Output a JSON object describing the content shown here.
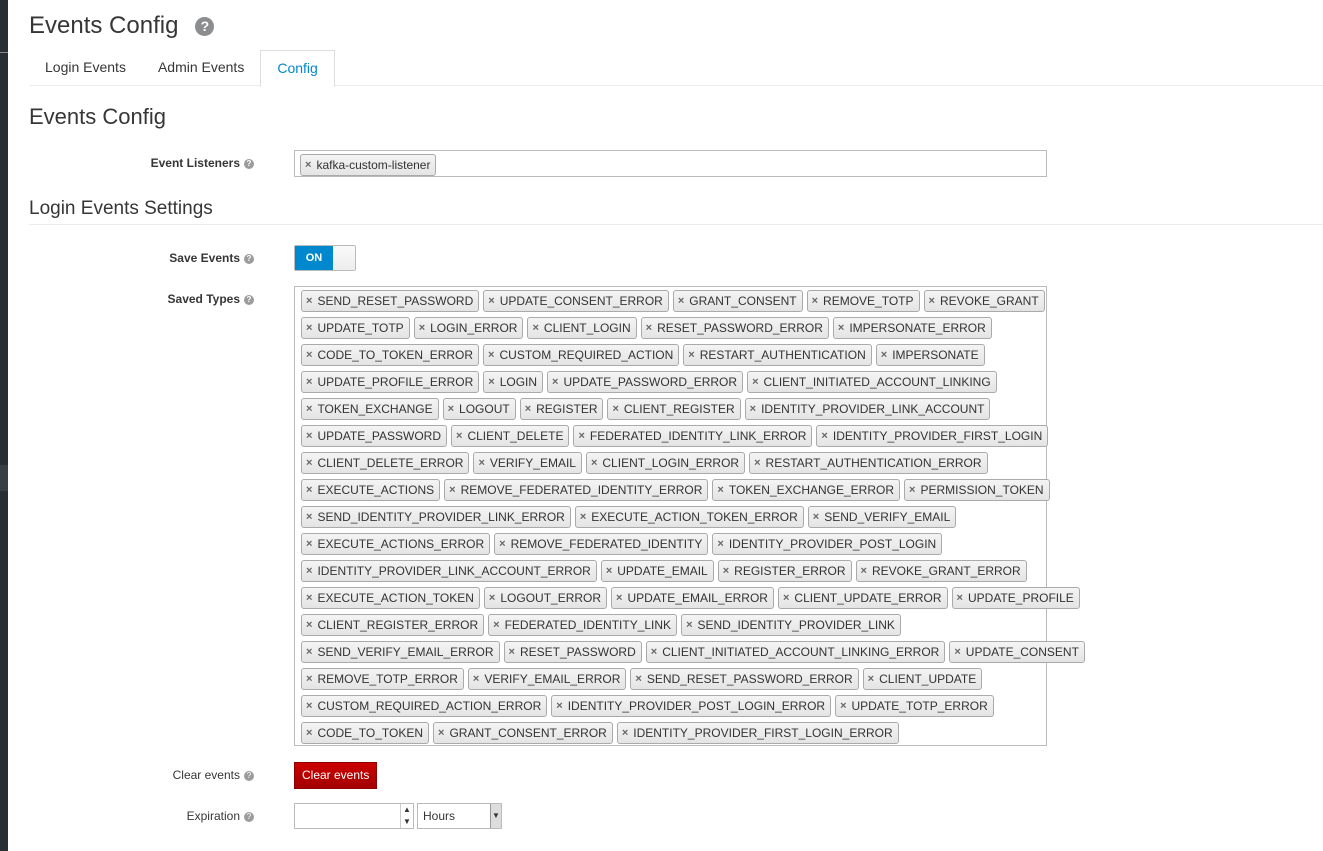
{
  "header": {
    "title": "Events Config"
  },
  "tabs": [
    {
      "label": "Login Events"
    },
    {
      "label": "Admin Events"
    },
    {
      "label": "Config"
    }
  ],
  "section_title": "Events Config",
  "event_listeners": {
    "label": "Event Listeners",
    "tags": [
      "kafka-custom-listener"
    ]
  },
  "login_settings": {
    "title": "Login Events Settings",
    "save_events_label": "Save Events",
    "save_events_value": "ON",
    "saved_types_label": "Saved Types",
    "saved_types_rows": [
      [
        "SEND_RESET_PASSWORD",
        "UPDATE_CONSENT_ERROR",
        "GRANT_CONSENT",
        "REMOVE_TOTP",
        "REVOKE_GRANT"
      ],
      [
        "UPDATE_TOTP",
        "LOGIN_ERROR",
        "CLIENT_LOGIN",
        "RESET_PASSWORD_ERROR",
        "IMPERSONATE_ERROR"
      ],
      [
        "CODE_TO_TOKEN_ERROR",
        "CUSTOM_REQUIRED_ACTION",
        "RESTART_AUTHENTICATION",
        "IMPERSONATE"
      ],
      [
        "UPDATE_PROFILE_ERROR",
        "LOGIN",
        "UPDATE_PASSWORD_ERROR",
        "CLIENT_INITIATED_ACCOUNT_LINKING"
      ],
      [
        "TOKEN_EXCHANGE",
        "LOGOUT",
        "REGISTER",
        "CLIENT_REGISTER",
        "IDENTITY_PROVIDER_LINK_ACCOUNT"
      ],
      [
        "UPDATE_PASSWORD",
        "CLIENT_DELETE",
        "FEDERATED_IDENTITY_LINK_ERROR",
        "IDENTITY_PROVIDER_FIRST_LOGIN"
      ],
      [
        "CLIENT_DELETE_ERROR",
        "VERIFY_EMAIL",
        "CLIENT_LOGIN_ERROR",
        "RESTART_AUTHENTICATION_ERROR"
      ],
      [
        "EXECUTE_ACTIONS",
        "REMOVE_FEDERATED_IDENTITY_ERROR",
        "TOKEN_EXCHANGE_ERROR",
        "PERMISSION_TOKEN"
      ],
      [
        "SEND_IDENTITY_PROVIDER_LINK_ERROR",
        "EXECUTE_ACTION_TOKEN_ERROR",
        "SEND_VERIFY_EMAIL"
      ],
      [
        "EXECUTE_ACTIONS_ERROR",
        "REMOVE_FEDERATED_IDENTITY",
        "IDENTITY_PROVIDER_POST_LOGIN"
      ],
      [
        "IDENTITY_PROVIDER_LINK_ACCOUNT_ERROR",
        "UPDATE_EMAIL",
        "REGISTER_ERROR",
        "REVOKE_GRANT_ERROR"
      ],
      [
        "EXECUTE_ACTION_TOKEN",
        "LOGOUT_ERROR",
        "UPDATE_EMAIL_ERROR",
        "CLIENT_UPDATE_ERROR",
        "UPDATE_PROFILE"
      ],
      [
        "CLIENT_REGISTER_ERROR",
        "FEDERATED_IDENTITY_LINK",
        "SEND_IDENTITY_PROVIDER_LINK"
      ],
      [
        "SEND_VERIFY_EMAIL_ERROR",
        "RESET_PASSWORD",
        "CLIENT_INITIATED_ACCOUNT_LINKING_ERROR",
        "UPDATE_CONSENT"
      ],
      [
        "REMOVE_TOTP_ERROR",
        "VERIFY_EMAIL_ERROR",
        "SEND_RESET_PASSWORD_ERROR",
        "CLIENT_UPDATE"
      ],
      [
        "CUSTOM_REQUIRED_ACTION_ERROR",
        "IDENTITY_PROVIDER_POST_LOGIN_ERROR",
        "UPDATE_TOTP_ERROR"
      ],
      [
        "CODE_TO_TOKEN",
        "GRANT_CONSENT_ERROR",
        "IDENTITY_PROVIDER_FIRST_LOGIN_ERROR"
      ]
    ],
    "clear_events_label": "Clear events",
    "clear_events_button": "Clear events",
    "expiration_label": "Expiration",
    "expiration_value": "",
    "expiration_unit": "Hours"
  }
}
